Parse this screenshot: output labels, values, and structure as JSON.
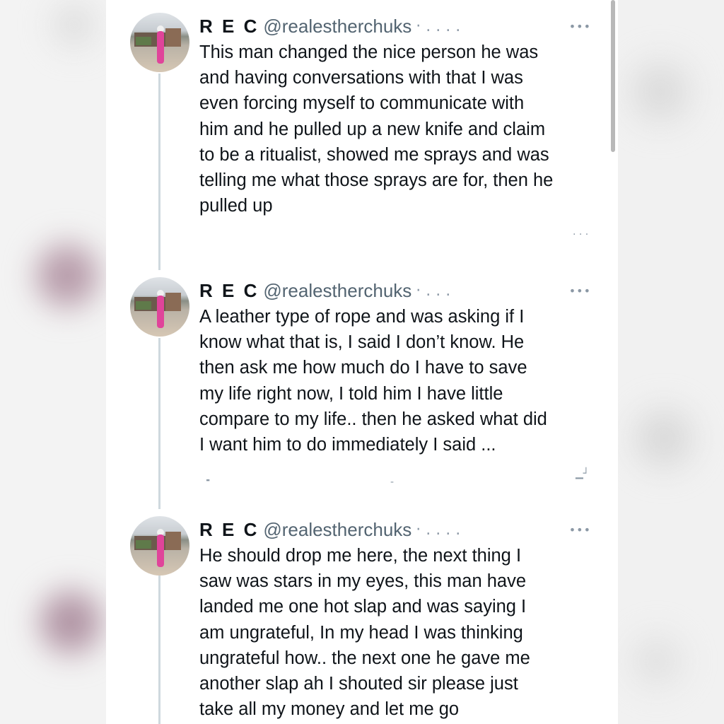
{
  "tweets": [
    {
      "name": "R E C",
      "handle": "@realestherchuks",
      "separator": "· . . . .",
      "more_icon": "more-horizontal-icon",
      "lines": [
        "This man changed the nice person he was",
        "and having conversations with that I was",
        "even forcing myself to communicate with",
        "him and he pulled up a new knife and claim",
        "to be a ritualist, showed me sprays and was",
        "telling me what those sprays are for, then he",
        "pulled up"
      ]
    },
    {
      "name": "R E C",
      "handle": "@realestherchuks",
      "separator": "· . . .",
      "more_icon": "more-horizontal-icon",
      "lines": [
        "A leather type of rope and was asking if I",
        "know what that is, I said I don’t know. He",
        "then ask me how much do I have to save",
        "my life right now, I told him I have little",
        "compare to my life.. then he asked what did",
        "I want him to do immediately I said ..."
      ]
    },
    {
      "name": "R E C",
      "handle": "@realestherchuks",
      "separator": "· . . . .",
      "more_icon": "more-horizontal-icon",
      "lines": [
        "He should drop me here, the next thing I",
        "saw was stars in my eyes, this man have",
        "landed me one hot slap and was saying I",
        "am ungrateful, In my head I was thinking",
        "ungrateful how.. the next one he gave me",
        "another slap ah I shouted sir please just",
        "take all my money and let me go"
      ]
    }
  ]
}
